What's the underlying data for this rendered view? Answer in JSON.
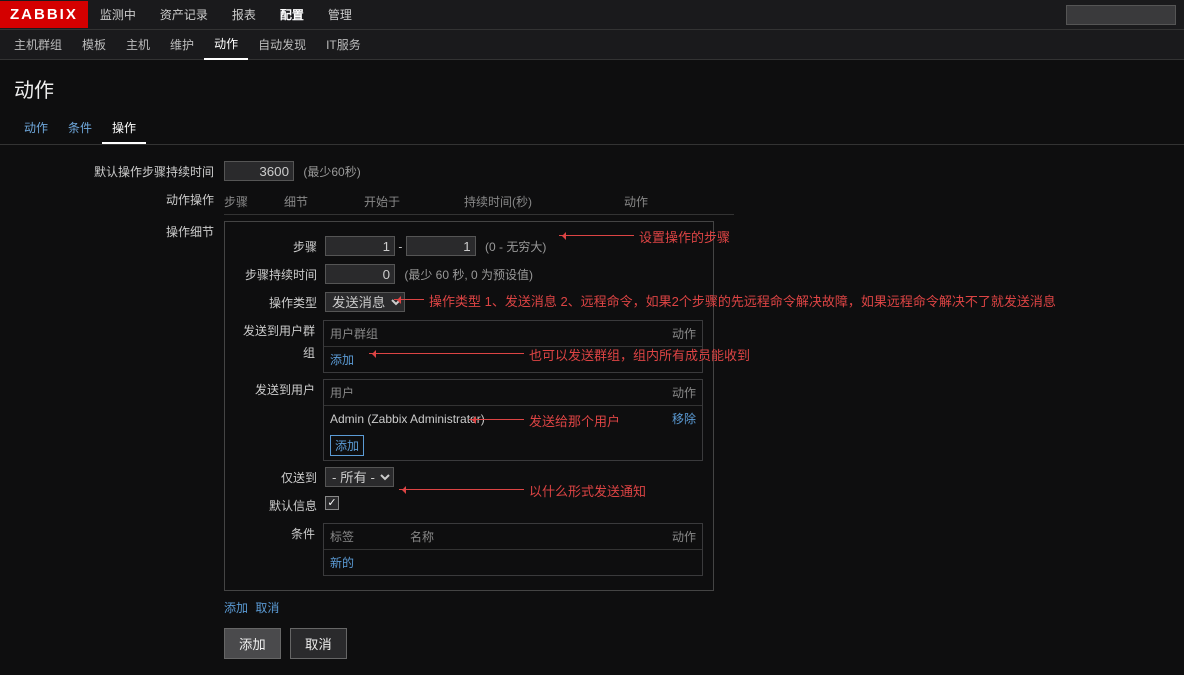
{
  "logo": "ZABBIX",
  "topnav": {
    "items": [
      "监测中",
      "资产记录",
      "报表",
      "配置",
      "管理"
    ],
    "active_index": 3
  },
  "subnav": {
    "items": [
      "主机群组",
      "模板",
      "主机",
      "维护",
      "动作",
      "自动发现",
      "IT服务"
    ],
    "active_index": 4
  },
  "page_title": "动作",
  "tabs": {
    "items": [
      "动作",
      "条件",
      "操作"
    ],
    "active_index": 2
  },
  "form": {
    "default_step_duration_label": "默认操作步骤持续时间",
    "default_step_duration_value": "3600",
    "default_step_duration_hint": "(最少60秒)",
    "action_operation_label": "动作操作",
    "op_cols": {
      "step": "步骤",
      "detail": "细节",
      "start": "开始于",
      "duration": "持续时间(秒)",
      "action": "动作"
    },
    "operation_detail_label": "操作细节"
  },
  "detail": {
    "step_label": "步骤",
    "step_from": "1",
    "step_to": "1",
    "step_hint": "(0 - 无穷大)",
    "step_duration_label": "步骤持续时间",
    "step_duration_value": "0",
    "step_duration_hint": "(最少 60 秒, 0 为预设值)",
    "op_type_label": "操作类型",
    "op_type_value": "发送消息",
    "send_group_label": "发送到用户群组",
    "group_col_name": "用户群组",
    "group_col_action": "动作",
    "add_link": "添加",
    "send_user_label": "发送到用户",
    "user_col_name": "用户",
    "user_col_action": "动作",
    "user_value": "Admin (Zabbix Administrator)",
    "user_remove": "移除",
    "only_send_label": "仅送到",
    "only_send_value": "- 所有 -",
    "default_msg_label": "默认信息",
    "default_msg_checked": true,
    "cond_label": "条件",
    "cond_col_tag": "标签",
    "cond_col_name": "名称",
    "cond_col_action": "动作",
    "cond_new": "新的"
  },
  "footer": {
    "add": "添加",
    "cancel": "取消",
    "btn_add": "添加",
    "btn_cancel": "取消"
  },
  "annotations": {
    "a1": "设置操作的步骤",
    "a2": "操作类型 1、发送消息 2、远程命令，如果2个步骤的先远程命令解决故障，如果远程命令解决不了就发送消息",
    "a3": "也可以发送群组，组内所有成员能收到",
    "a4": "发送给那个用户",
    "a5": "以什么形式发送通知"
  }
}
